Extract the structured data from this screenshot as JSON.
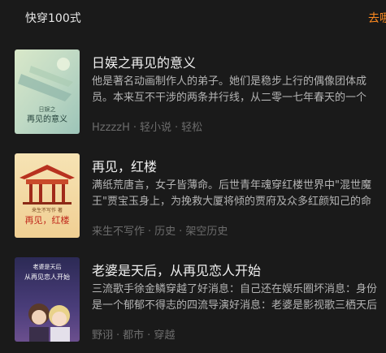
{
  "header": {
    "title": "快穿100式",
    "more": "去哪"
  },
  "books": [
    {
      "title": "日娱之再见的意义",
      "desc_line1": "他是著名动画制作人的弟子。她们是稳步上行的偶像团体成",
      "desc_line2": "员。本来互不干涉的两条并行线，从二零一七年春天的一个",
      "author": "HzzzzH",
      "tag1": "轻小说",
      "tag2": "轻松",
      "cover_title": "再见的意义",
      "cover_sub": "日娱之"
    },
    {
      "title": "再见，红楼",
      "desc_line1": "满纸荒唐言，女子皆薄命。后世青年魂穿红楼世界中\"混世魔",
      "desc_line2": "王\"贾宝玉身上，为挽救大厦将倾的贾府及众多红颜知己的命",
      "author": "来生不写作",
      "tag1": "历史",
      "tag2": "架空历史",
      "cover_title": "再见，红楼",
      "cover_sub": "来生不写作 著"
    },
    {
      "title": "老婆是天后，从再见恋人开始",
      "desc_line1": "三流歌手徐金鳞穿越了好消息：自己还在娱乐圈坏消息：身份",
      "desc_line2": "是一个郁郁不得志的四流导演好消息：老婆是影视歌三栖天后",
      "author": "野诩",
      "tag1": "都市",
      "tag2": "穿越",
      "cover_title": "从再见恋人开始",
      "cover_sub": "老婆是天后"
    }
  ]
}
